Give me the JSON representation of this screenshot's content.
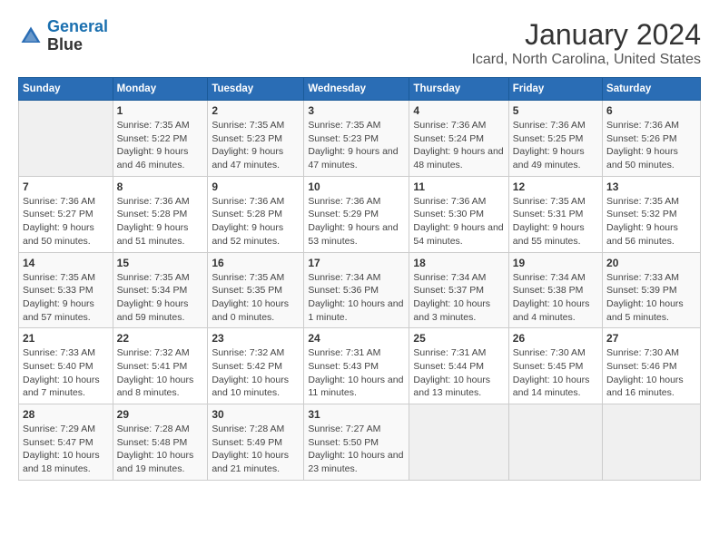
{
  "header": {
    "logo_line1": "General",
    "logo_line2": "Blue",
    "title": "January 2024",
    "subtitle": "Icard, North Carolina, United States"
  },
  "weekdays": [
    "Sunday",
    "Monday",
    "Tuesday",
    "Wednesday",
    "Thursday",
    "Friday",
    "Saturday"
  ],
  "weeks": [
    [
      {
        "day": "",
        "sunrise": "",
        "sunset": "",
        "daylight": ""
      },
      {
        "day": "1",
        "sunrise": "Sunrise: 7:35 AM",
        "sunset": "Sunset: 5:22 PM",
        "daylight": "Daylight: 9 hours and 46 minutes."
      },
      {
        "day": "2",
        "sunrise": "Sunrise: 7:35 AM",
        "sunset": "Sunset: 5:23 PM",
        "daylight": "Daylight: 9 hours and 47 minutes."
      },
      {
        "day": "3",
        "sunrise": "Sunrise: 7:35 AM",
        "sunset": "Sunset: 5:23 PM",
        "daylight": "Daylight: 9 hours and 47 minutes."
      },
      {
        "day": "4",
        "sunrise": "Sunrise: 7:36 AM",
        "sunset": "Sunset: 5:24 PM",
        "daylight": "Daylight: 9 hours and 48 minutes."
      },
      {
        "day": "5",
        "sunrise": "Sunrise: 7:36 AM",
        "sunset": "Sunset: 5:25 PM",
        "daylight": "Daylight: 9 hours and 49 minutes."
      },
      {
        "day": "6",
        "sunrise": "Sunrise: 7:36 AM",
        "sunset": "Sunset: 5:26 PM",
        "daylight": "Daylight: 9 hours and 50 minutes."
      }
    ],
    [
      {
        "day": "7",
        "sunrise": "Sunrise: 7:36 AM",
        "sunset": "Sunset: 5:27 PM",
        "daylight": "Daylight: 9 hours and 50 minutes."
      },
      {
        "day": "8",
        "sunrise": "Sunrise: 7:36 AM",
        "sunset": "Sunset: 5:28 PM",
        "daylight": "Daylight: 9 hours and 51 minutes."
      },
      {
        "day": "9",
        "sunrise": "Sunrise: 7:36 AM",
        "sunset": "Sunset: 5:28 PM",
        "daylight": "Daylight: 9 hours and 52 minutes."
      },
      {
        "day": "10",
        "sunrise": "Sunrise: 7:36 AM",
        "sunset": "Sunset: 5:29 PM",
        "daylight": "Daylight: 9 hours and 53 minutes."
      },
      {
        "day": "11",
        "sunrise": "Sunrise: 7:36 AM",
        "sunset": "Sunset: 5:30 PM",
        "daylight": "Daylight: 9 hours and 54 minutes."
      },
      {
        "day": "12",
        "sunrise": "Sunrise: 7:35 AM",
        "sunset": "Sunset: 5:31 PM",
        "daylight": "Daylight: 9 hours and 55 minutes."
      },
      {
        "day": "13",
        "sunrise": "Sunrise: 7:35 AM",
        "sunset": "Sunset: 5:32 PM",
        "daylight": "Daylight: 9 hours and 56 minutes."
      }
    ],
    [
      {
        "day": "14",
        "sunrise": "Sunrise: 7:35 AM",
        "sunset": "Sunset: 5:33 PM",
        "daylight": "Daylight: 9 hours and 57 minutes."
      },
      {
        "day": "15",
        "sunrise": "Sunrise: 7:35 AM",
        "sunset": "Sunset: 5:34 PM",
        "daylight": "Daylight: 9 hours and 59 minutes."
      },
      {
        "day": "16",
        "sunrise": "Sunrise: 7:35 AM",
        "sunset": "Sunset: 5:35 PM",
        "daylight": "Daylight: 10 hours and 0 minutes."
      },
      {
        "day": "17",
        "sunrise": "Sunrise: 7:34 AM",
        "sunset": "Sunset: 5:36 PM",
        "daylight": "Daylight: 10 hours and 1 minute."
      },
      {
        "day": "18",
        "sunrise": "Sunrise: 7:34 AM",
        "sunset": "Sunset: 5:37 PM",
        "daylight": "Daylight: 10 hours and 3 minutes."
      },
      {
        "day": "19",
        "sunrise": "Sunrise: 7:34 AM",
        "sunset": "Sunset: 5:38 PM",
        "daylight": "Daylight: 10 hours and 4 minutes."
      },
      {
        "day": "20",
        "sunrise": "Sunrise: 7:33 AM",
        "sunset": "Sunset: 5:39 PM",
        "daylight": "Daylight: 10 hours and 5 minutes."
      }
    ],
    [
      {
        "day": "21",
        "sunrise": "Sunrise: 7:33 AM",
        "sunset": "Sunset: 5:40 PM",
        "daylight": "Daylight: 10 hours and 7 minutes."
      },
      {
        "day": "22",
        "sunrise": "Sunrise: 7:32 AM",
        "sunset": "Sunset: 5:41 PM",
        "daylight": "Daylight: 10 hours and 8 minutes."
      },
      {
        "day": "23",
        "sunrise": "Sunrise: 7:32 AM",
        "sunset": "Sunset: 5:42 PM",
        "daylight": "Daylight: 10 hours and 10 minutes."
      },
      {
        "day": "24",
        "sunrise": "Sunrise: 7:31 AM",
        "sunset": "Sunset: 5:43 PM",
        "daylight": "Daylight: 10 hours and 11 minutes."
      },
      {
        "day": "25",
        "sunrise": "Sunrise: 7:31 AM",
        "sunset": "Sunset: 5:44 PM",
        "daylight": "Daylight: 10 hours and 13 minutes."
      },
      {
        "day": "26",
        "sunrise": "Sunrise: 7:30 AM",
        "sunset": "Sunset: 5:45 PM",
        "daylight": "Daylight: 10 hours and 14 minutes."
      },
      {
        "day": "27",
        "sunrise": "Sunrise: 7:30 AM",
        "sunset": "Sunset: 5:46 PM",
        "daylight": "Daylight: 10 hours and 16 minutes."
      }
    ],
    [
      {
        "day": "28",
        "sunrise": "Sunrise: 7:29 AM",
        "sunset": "Sunset: 5:47 PM",
        "daylight": "Daylight: 10 hours and 18 minutes."
      },
      {
        "day": "29",
        "sunrise": "Sunrise: 7:28 AM",
        "sunset": "Sunset: 5:48 PM",
        "daylight": "Daylight: 10 hours and 19 minutes."
      },
      {
        "day": "30",
        "sunrise": "Sunrise: 7:28 AM",
        "sunset": "Sunset: 5:49 PM",
        "daylight": "Daylight: 10 hours and 21 minutes."
      },
      {
        "day": "31",
        "sunrise": "Sunrise: 7:27 AM",
        "sunset": "Sunset: 5:50 PM",
        "daylight": "Daylight: 10 hours and 23 minutes."
      },
      {
        "day": "",
        "sunrise": "",
        "sunset": "",
        "daylight": ""
      },
      {
        "day": "",
        "sunrise": "",
        "sunset": "",
        "daylight": ""
      },
      {
        "day": "",
        "sunrise": "",
        "sunset": "",
        "daylight": ""
      }
    ]
  ]
}
